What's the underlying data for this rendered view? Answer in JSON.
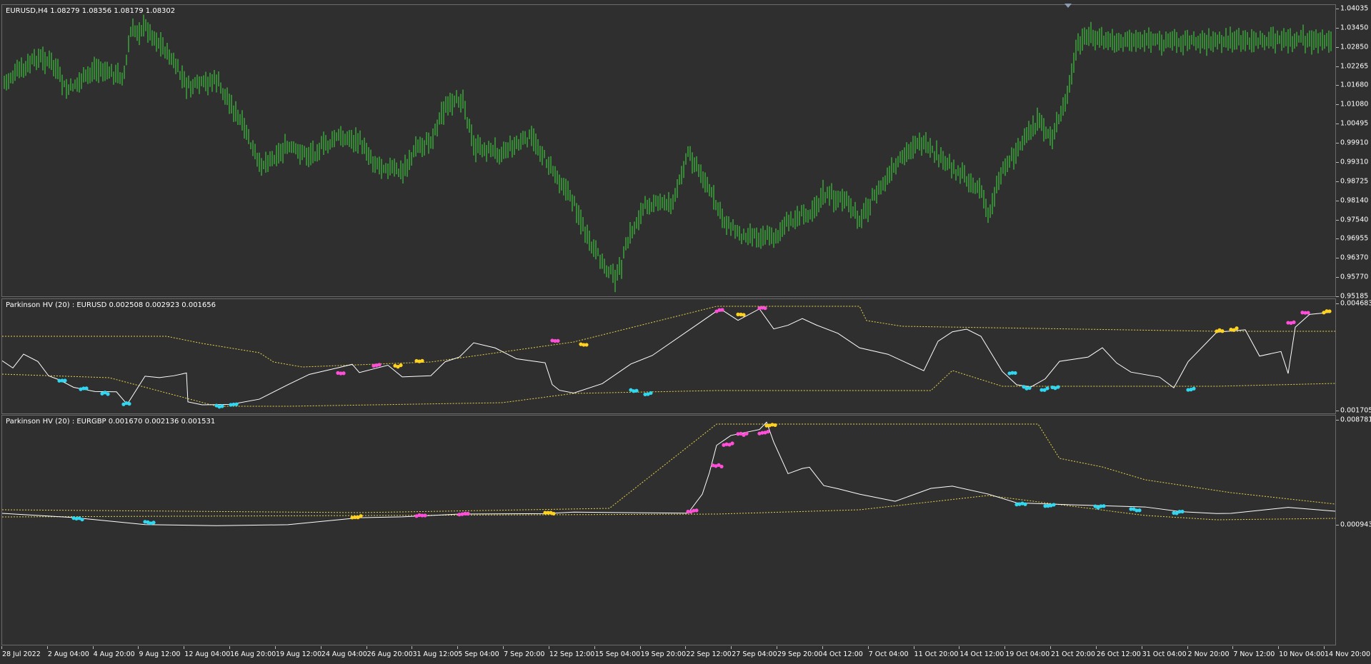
{
  "main_chart": {
    "label": "EURUSD,H4  1.08279 1.08356 1.08179 1.08302",
    "price_labels": [
      "1.04035",
      "1.03450",
      "1.02850",
      "1.02265",
      "1.01680",
      "1.01080",
      "1.00495",
      "0.99910",
      "0.99310",
      "0.98725",
      "0.98140",
      "0.97540",
      "0.96955",
      "0.96370",
      "0.95770",
      "0.95185"
    ],
    "candle_color": "#3ee23e"
  },
  "indicator_1": {
    "label": "Parkinson HV (20) : EURUSD 0.002508 0.002923 0.001656",
    "scale_labels": [
      "0.004683",
      "0.001705"
    ]
  },
  "indicator_2": {
    "label": "Parkinson HV (20) : EURGBP 0.001670 0.002136 0.001531",
    "scale_labels": [
      "0.008781",
      "0.000943"
    ]
  },
  "time_axis": [
    "28 Jul 2022",
    "2 Aug 04:00",
    "4 Aug 20:00",
    "9 Aug 12:00",
    "12 Aug 04:00",
    "16 Aug 20:00",
    "19 Aug 12:00",
    "24 Aug 04:00",
    "26 Aug 20:00",
    "31 Aug 12:00",
    "5 Sep 04:00",
    "7 Sep 20:00",
    "12 Sep 12:00",
    "15 Sep 04:00",
    "19 Sep 20:00",
    "22 Sep 12:00",
    "27 Sep 04:00",
    "29 Sep 20:00",
    "4 Oct 12:00",
    "7 Oct 04:00",
    "11 Oct 20:00",
    "14 Oct 12:00",
    "19 Oct 04:00",
    "21 Oct 20:00",
    "26 Oct 12:00",
    "31 Oct 04:00",
    "2 Nov 20:00",
    "7 Nov 12:00",
    "10 Nov 04:00",
    "14 Nov 20:00"
  ],
  "colors": {
    "background": "#2f2f2f",
    "hv_line": "#ffffff",
    "band_line": "#e8d24a",
    "high_dot": "#ff4fd8",
    "mid_dot": "#ffd21f",
    "low_dot": "#2fd7f0"
  }
}
